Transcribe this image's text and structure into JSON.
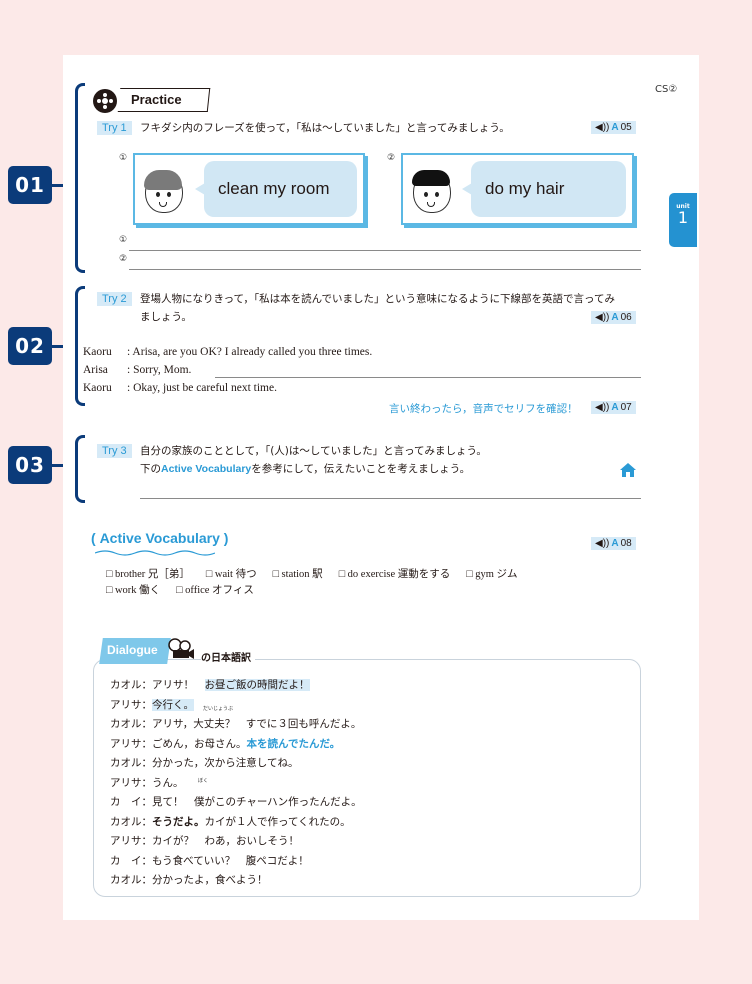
{
  "header": {
    "cs_label": "CS②"
  },
  "unit_tab": {
    "label": "unit",
    "number": "1"
  },
  "markers": [
    "01",
    "02",
    "03"
  ],
  "practice": {
    "title": "Practice",
    "try1": {
      "tag": "Try 1",
      "instruction": "フキダシ内のフレーズを使って，「私は～していました」と言ってみましょう。",
      "audio": {
        "prefix": "A",
        "number": "05"
      },
      "cards": [
        {
          "num": "①",
          "phrase": "clean my room",
          "character": "girl"
        },
        {
          "num": "②",
          "phrase": "do my hair",
          "character": "boy"
        }
      ],
      "answer_lines": [
        "①",
        "②"
      ]
    },
    "try2": {
      "tag": "Try 2",
      "instruction_line1": "登場人物になりきって，「私は本を読んでいました」という意味になるように下線部を英語で言ってみ",
      "instruction_line2": "ましょう。",
      "audio": {
        "prefix": "A",
        "number": "06"
      },
      "dialogue": [
        {
          "speaker": "Kaoru",
          "text": ": Arisa, are you OK? I already called you three times."
        },
        {
          "speaker": "Arisa",
          "text": ": Sorry, Mom."
        },
        {
          "speaker": "Kaoru",
          "text": ": Okay, just be careful next time."
        }
      ],
      "check_message": "言い終わったら，音声でセリフを確認！",
      "check_audio": {
        "prefix": "A",
        "number": "07"
      }
    },
    "try3": {
      "tag": "Try 3",
      "instruction_line1": "自分の家族のこととして，「(人)は～していました」と言ってみましょう。",
      "instruction_line2_pre": "下の",
      "instruction_line2_link": "Active Vocabulary",
      "instruction_line2_post": "を参考にして，伝えたいことを考えましょう。",
      "home_icon": "home-icon"
    }
  },
  "active_vocabulary": {
    "title": "Active Vocabulary",
    "audio": {
      "prefix": "A",
      "number": "08"
    },
    "row1": [
      "□ brother 兄［弟］",
      "□ wait 待つ",
      "□ station 駅",
      "□ do exercise 運動をする",
      "□ gym ジム"
    ],
    "row2": [
      "□ work 働く",
      "□ office オフィス"
    ]
  },
  "dialogue_translation": {
    "tab_label": "Dialogue",
    "title": "の日本語訳",
    "lines": [
      {
        "speaker": "カオル：",
        "parts": [
          {
            "t": "アリサ！　",
            "s": ""
          },
          {
            "t": "お昼ご飯の時間だよ！",
            "s": "hl"
          }
        ]
      },
      {
        "speaker": "アリサ：",
        "parts": [
          {
            "t": "今行く。",
            "s": "hl"
          }
        ]
      },
      {
        "speaker": "カオル：",
        "parts": [
          {
            "t": "アリサ，大丈夫？　すでに３回も呼んだよ。",
            "s": ""
          }
        ]
      },
      {
        "speaker": "アリサ：",
        "parts": [
          {
            "t": "ごめん，お母さん。",
            "s": ""
          },
          {
            "t": "本を読んでたんだ。",
            "s": "blue"
          }
        ]
      },
      {
        "speaker": "カオル：",
        "parts": [
          {
            "t": "分かった，次から注意してね。",
            "s": ""
          }
        ]
      },
      {
        "speaker": "アリサ：",
        "parts": [
          {
            "t": "うん。",
            "s": ""
          }
        ]
      },
      {
        "speaker": "カ　イ：",
        "parts": [
          {
            "t": "見て！　僕がこのチャーハン作ったんだよ。",
            "s": ""
          }
        ]
      },
      {
        "speaker": "カオル：",
        "parts": [
          {
            "t": "そうだよ。",
            "s": "bold"
          },
          {
            "t": "カイが１人で作ってくれたの。",
            "s": ""
          }
        ]
      },
      {
        "speaker": "アリサ：",
        "parts": [
          {
            "t": "カイが？　わあ，おいしそう！",
            "s": ""
          }
        ]
      },
      {
        "speaker": "カ　イ：",
        "parts": [
          {
            "t": "もう食べていい？　腹ペコだよ！",
            "s": ""
          }
        ]
      },
      {
        "speaker": "カオル：",
        "parts": [
          {
            "t": "分かったよ，食べよう！",
            "s": ""
          }
        ]
      }
    ],
    "ruby": {
      "daijoubu": "だいじょうぶ",
      "boku": "ぼく"
    }
  },
  "colors": {
    "navy": "#0b3b7a",
    "accent_blue": "#2a9ad5",
    "highlight": "#d6eaf7",
    "background": "#fce9e8"
  }
}
